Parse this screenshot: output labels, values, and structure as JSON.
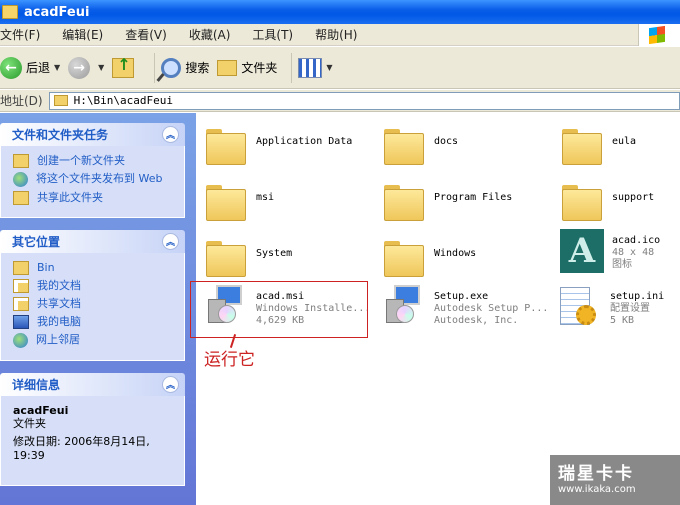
{
  "window": {
    "title": "acadFeui"
  },
  "menu": [
    "文件(F)",
    "编辑(E)",
    "查看(V)",
    "收藏(A)",
    "工具(T)",
    "帮助(H)"
  ],
  "toolbar": {
    "back": "后退",
    "search": "搜索",
    "folders": "文件夹"
  },
  "address": {
    "label": "地址(D)",
    "path": "H:\\Bin\\acadFeui"
  },
  "panels": {
    "tasks": {
      "title": "文件和文件夹任务",
      "items": [
        "创建一个新文件夹",
        "将这个文件夹发布到 Web",
        "共享此文件夹"
      ]
    },
    "places": {
      "title": "其它位置",
      "items": [
        "Bin",
        "我的文档",
        "共享文档",
        "我的电脑",
        "网上邻居"
      ]
    },
    "details": {
      "title": "详细信息",
      "name": "acadFeui",
      "type": "文件夹",
      "modified": "修改日期: 2006年8月14日, 19:39"
    }
  },
  "files": [
    {
      "name": "Application Data"
    },
    {
      "name": "docs"
    },
    {
      "name": "eula"
    },
    {
      "name": "msi"
    },
    {
      "name": "Program Files"
    },
    {
      "name": "support"
    },
    {
      "name": "System"
    },
    {
      "name": "Windows"
    },
    {
      "name": "acad.ico",
      "line2": "48 x 48",
      "line3": "图标"
    },
    {
      "name": "acad.msi",
      "line2": "Windows Installe...",
      "line3": "4,629 KB"
    },
    {
      "name": "Setup.exe",
      "line2": "Autodesk Setup P...",
      "line3": "Autodesk, Inc."
    },
    {
      "name": "setup.ini",
      "line2": "配置设置",
      "line3": "5 KB"
    }
  ],
  "annotation": "运行它",
  "watermark": {
    "title": "瑞星卡卡",
    "url": "www.ikaka.com"
  }
}
